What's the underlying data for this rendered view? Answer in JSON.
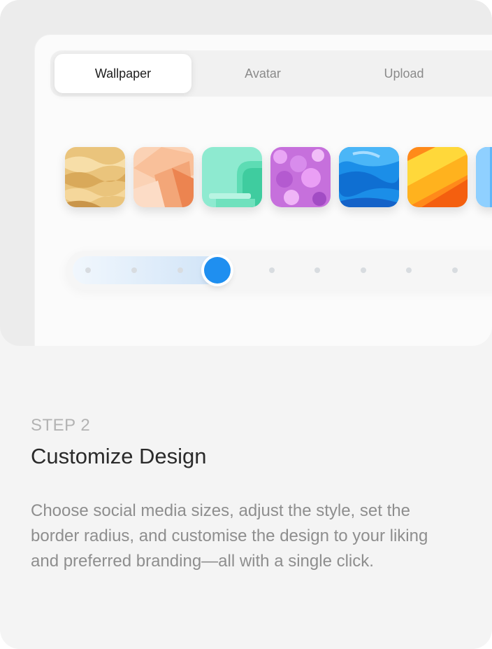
{
  "tabs": [
    {
      "label": "Wallpaper",
      "active": true
    },
    {
      "label": "Avatar",
      "active": false
    },
    {
      "label": "Upload",
      "active": false
    }
  ],
  "wallpapers": [
    {
      "name": "golden-sand",
      "colors": [
        "#f3d596",
        "#c89a4f"
      ]
    },
    {
      "name": "peach-shapes",
      "colors": [
        "#fbd6bb",
        "#ef9462"
      ]
    },
    {
      "name": "mint-arches",
      "colors": [
        "#9ff0d6",
        "#3fd3a5"
      ]
    },
    {
      "name": "purple-bokeh",
      "colors": [
        "#e39cf1",
        "#b25ad4"
      ]
    },
    {
      "name": "blue-liquid",
      "colors": [
        "#8fd3ff",
        "#1e66db"
      ]
    },
    {
      "name": "orange-yellow-wave",
      "colors": [
        "#ffe14d",
        "#ff6f12"
      ]
    },
    {
      "name": "sky-blue",
      "colors": [
        "#9ad7ff",
        "#4aa9f5"
      ]
    }
  ],
  "slider": {
    "value_fraction": 0.35,
    "steps": 9,
    "accent": "#1f8ff0"
  },
  "step": {
    "label": "STEP 2",
    "title": "Customize Design",
    "description": "Choose social media sizes, adjust the style, set the border radius, and customise the design to your liking and preferred branding—all with a single click."
  }
}
